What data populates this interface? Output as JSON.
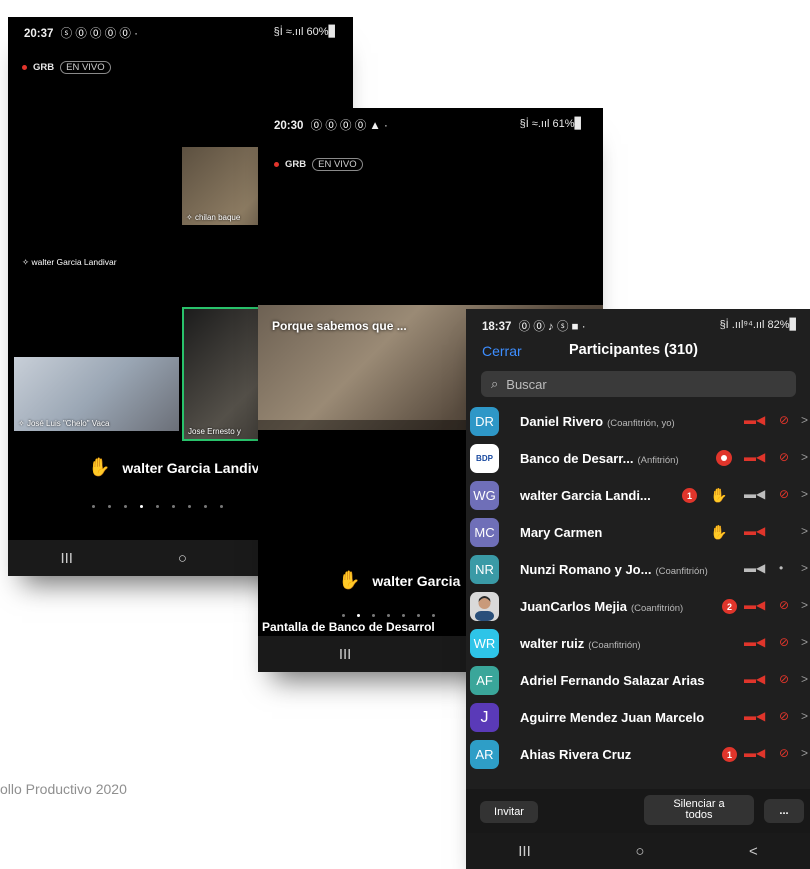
{
  "footer_text": "ollo Productivo 2020",
  "phone1": {
    "time": "20:37",
    "status_icons": "ⓢ ⓪ ⓪ ⓪ ⓪ ·",
    "status_right": "§İ ≈.ııl 60%▊",
    "live": {
      "grb": "GRB",
      "en_vivo": "EN VIVO"
    },
    "tiles": [
      {
        "label": "chilan baque"
      },
      {
        "label": "José Luis \"Chelo\" Vaca"
      },
      {
        "label": "Jose Ernesto y"
      }
    ],
    "name_label": "walter Garcia Landivar",
    "raised_hand_name": "walter Garcia Landiv",
    "nav": {
      "recents": "III",
      "home": "○",
      "back": "<"
    }
  },
  "phone2": {
    "time": "20:30",
    "status_icons": "⓪ ⓪ ⓪ ⓪ ▲ ·",
    "status_right": "§İ ≈.ııl 61%▊",
    "live": {
      "grb": "GRB",
      "en_vivo": "EN VIVO"
    },
    "video_caption": "Porque sabemos que ...",
    "raised_hand_name": "walter Garcia",
    "screen_label": "Pantalla de Banco de Desarrol",
    "nav": {
      "recents": "III",
      "home": "○"
    }
  },
  "phone3": {
    "time": "18:37",
    "status_icons": "⓪ ⓪ ♪ ⓢ ■ ·",
    "status_right": "§İ .ııl⁹⁴.ııl 82%▊",
    "close_label": "Cerrar",
    "title": "Participantes (310)",
    "search_placeholder": "Buscar",
    "participants": [
      {
        "initials": "DR",
        "color": "#2e97c7",
        "name": "Daniel Rivero",
        "role": "(Coanfitrión, yo)",
        "video": "off",
        "mic": "off"
      },
      {
        "initials": "BDP",
        "color": "#ffffff",
        "name": "Banco de Desarr...",
        "role": "(Anfitrión)",
        "recording": true,
        "video": "off",
        "mic": "off"
      },
      {
        "initials": "WG",
        "color": "#6f6fb8",
        "name": "walter Garcia Landi...",
        "role": "",
        "badge": "1",
        "hand": true,
        "video": "on",
        "mic": "off"
      },
      {
        "initials": "MC",
        "color": "#6f6fb8",
        "name": "Mary Carmen",
        "role": "",
        "hand": true,
        "video": "off",
        "mic": "none"
      },
      {
        "initials": "NR",
        "color": "#3a9aa6",
        "name": "Nunzi Romano y Jo...",
        "role": "(Coanfitrión)",
        "video": "on",
        "mic": "on"
      },
      {
        "initials": "",
        "color": "#d9d9d9",
        "name": "JuanCarlos Mejia",
        "role": "(Coanfitrión)",
        "badge": "2",
        "photo": true,
        "video": "off",
        "mic": "off"
      },
      {
        "initials": "WR",
        "color": "#2ec4e8",
        "name": "walter ruiz",
        "role": "(Coanfitrión)",
        "video": "off",
        "mic": "off"
      },
      {
        "initials": "AF",
        "color": "#3aa69a",
        "name": "Adriel Fernando Salazar Arias",
        "role": "",
        "video": "off",
        "mic": "off"
      },
      {
        "initials": "J",
        "color": "#5a3ab8",
        "name": "Aguirre Mendez Juan Marcelo",
        "role": "",
        "video": "off",
        "mic": "off"
      },
      {
        "initials": "AR",
        "color": "#2e9ec7",
        "name": "Ahias Rivera Cruz",
        "role": "",
        "badge": "1",
        "video": "off",
        "mic": "off"
      }
    ],
    "buttons": {
      "invite": "Invitar",
      "mute_all_1": "Silenciar a",
      "mute_all_2": "todos",
      "more": "..."
    },
    "nav": {
      "recents": "III",
      "home": "○",
      "back": "<"
    }
  },
  "colors": {
    "hand": "#3b73ff",
    "muted": "#e0352b",
    "link": "#3d8eff"
  }
}
